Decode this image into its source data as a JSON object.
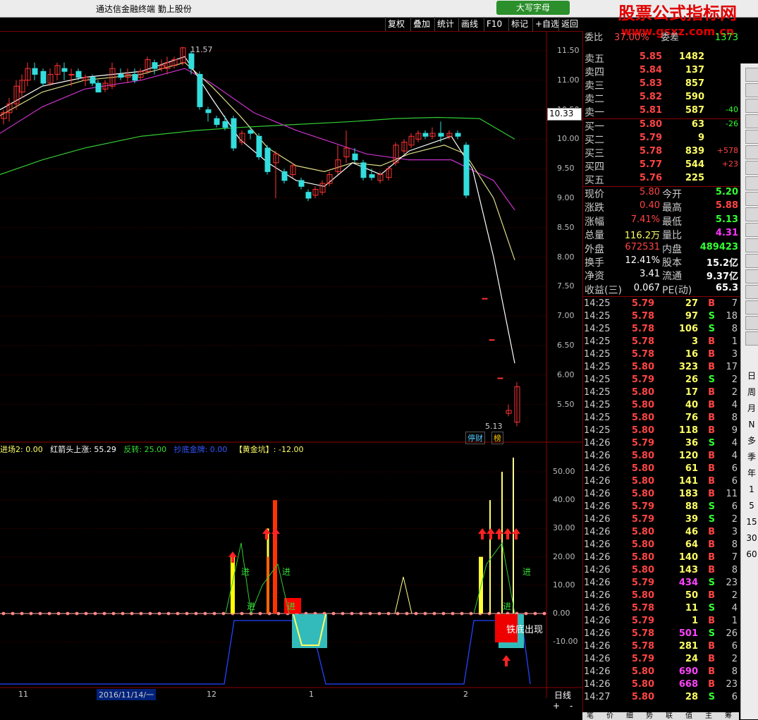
{
  "window": {
    "title": "通达信金融终端  勤上股份",
    "ime_label": "大写字母"
  },
  "watermark": {
    "line1": "股票公式指标网",
    "line2": "www.gsxz.com.cn"
  },
  "toolbar": {
    "items": [
      "复权",
      "叠加",
      "统计",
      "画线",
      "F10",
      "标记",
      "+自选",
      "返回"
    ]
  },
  "price_axis": {
    "labels": [
      "11.50",
      "11.00",
      "10.50",
      "10.00",
      "9.50",
      "9.00",
      "8.50",
      "8.00",
      "7.50",
      "7.00",
      "6.50",
      "6.00",
      "5.50"
    ],
    "current_price_tag": "10.33"
  },
  "main_chart": {
    "high_label": "11.57",
    "low_label": "5.13",
    "badges": [
      "停财",
      "榜"
    ]
  },
  "indicator": {
    "legend": [
      {
        "text": "进场2: 0.00",
        "color": "#ffff66"
      },
      {
        "text": "红箭头上涨: 55.29",
        "color": "#ffffff"
      },
      {
        "text": "反转: 25.00",
        "color": "#33dd33"
      },
      {
        "text": "抄底金牌: 0.00",
        "color": "#3355ff"
      },
      {
        "text": "【黄金坑】: -12.00",
        "color": "#ffff66"
      }
    ],
    "axis_labels": [
      "50.00",
      "40.00",
      "30.00",
      "20.00",
      "10.00",
      "0.00",
      "-10.00"
    ],
    "annotations": {
      "jin1": "进",
      "jin2": "进",
      "jin3": "进",
      "jin4": "进",
      "jin5": "进",
      "jin6": "进",
      "tiedi": "铁底出现"
    }
  },
  "date_axis": {
    "labels": [
      "11",
      "2016/11/14/一",
      "12",
      "1",
      "2"
    ],
    "period": "日线"
  },
  "quote": {
    "top_row": {
      "label": "委比",
      "value": "37.00%",
      "label2": "委差",
      "value2": "1373"
    },
    "sells": [
      {
        "label": "卖五",
        "price": "5.85",
        "vol": "1482",
        "chg": ""
      },
      {
        "label": "卖四",
        "price": "5.84",
        "vol": "137",
        "chg": ""
      },
      {
        "label": "卖三",
        "price": "5.83",
        "vol": "857",
        "chg": ""
      },
      {
        "label": "卖二",
        "price": "5.82",
        "vol": "590",
        "chg": ""
      },
      {
        "label": "卖一",
        "price": "5.81",
        "vol": "587",
        "chg": "-40"
      }
    ],
    "buys": [
      {
        "label": "买一",
        "price": "5.80",
        "vol": "63",
        "chg": "-26"
      },
      {
        "label": "买二",
        "price": "5.79",
        "vol": "9",
        "chg": ""
      },
      {
        "label": "买三",
        "price": "5.78",
        "vol": "839",
        "chg": "+578"
      },
      {
        "label": "买四",
        "price": "5.77",
        "vol": "544",
        "chg": "+23"
      },
      {
        "label": "买五",
        "price": "5.76",
        "vol": "225",
        "chg": ""
      }
    ],
    "stats": [
      {
        "l1": "现价",
        "v1": "5.80",
        "l2": "今开",
        "v2": "5.20",
        "c1": "#ff4444",
        "c2": "#33ff33"
      },
      {
        "l1": "涨跌",
        "v1": "0.40",
        "l2": "最高",
        "v2": "5.88",
        "c1": "#ff4444",
        "c2": "#ff4444"
      },
      {
        "l1": "涨幅",
        "v1": "7.41%",
        "l2": "最低",
        "v2": "5.13",
        "c1": "#ff4444",
        "c2": "#33ff33"
      },
      {
        "l1": "总量",
        "v1": "116.2万",
        "l2": "量比",
        "v2": "4.31",
        "c1": "#ffff66",
        "c2": "#ff33ff"
      },
      {
        "l1": "外盘",
        "v1": "672531",
        "l2": "内盘",
        "v2": "489423",
        "c1": "#ff4444",
        "c2": "#33ff33"
      },
      {
        "l1": "换手",
        "v1": "12.41%",
        "l2": "股本",
        "v2": "15.2亿",
        "c1": "#ffffff",
        "c2": "#ffffff"
      },
      {
        "l1": "净资",
        "v1": "3.41",
        "l2": "流通",
        "v2": "9.37亿",
        "c1": "#ffffff",
        "c2": "#ffffff"
      },
      {
        "l1": "收益(三)",
        "v1": "0.067",
        "l2": "PE(动)",
        "v2": "65.3",
        "c1": "#ffffff",
        "c2": "#ffffff"
      }
    ],
    "ticks": [
      [
        "14:25",
        "5.79",
        "27",
        "B",
        "7"
      ],
      [
        "14:25",
        "5.78",
        "97",
        "S",
        "18"
      ],
      [
        "14:25",
        "5.78",
        "106",
        "S",
        "8"
      ],
      [
        "14:25",
        "5.78",
        "3",
        "B",
        "1"
      ],
      [
        "14:25",
        "5.78",
        "16",
        "B",
        "3"
      ],
      [
        "14:25",
        "5.80",
        "323",
        "B",
        "17"
      ],
      [
        "14:25",
        "5.79",
        "26",
        "S",
        "2"
      ],
      [
        "14:25",
        "5.80",
        "17",
        "B",
        "2"
      ],
      [
        "14:25",
        "5.80",
        "40",
        "B",
        "4"
      ],
      [
        "14:25",
        "5.80",
        "76",
        "B",
        "8"
      ],
      [
        "14:25",
        "5.80",
        "118",
        "B",
        "9"
      ],
      [
        "14:26",
        "5.79",
        "36",
        "S",
        "4"
      ],
      [
        "14:26",
        "5.80",
        "120",
        "B",
        "4"
      ],
      [
        "14:26",
        "5.80",
        "61",
        "B",
        "6"
      ],
      [
        "14:26",
        "5.80",
        "141",
        "B",
        "6"
      ],
      [
        "14:26",
        "5.80",
        "183",
        "B",
        "11"
      ],
      [
        "14:26",
        "5.79",
        "88",
        "S",
        "6"
      ],
      [
        "14:26",
        "5.79",
        "39",
        "S",
        "2"
      ],
      [
        "14:26",
        "5.80",
        "46",
        "B",
        "3"
      ],
      [
        "14:26",
        "5.80",
        "64",
        "B",
        "8"
      ],
      [
        "14:26",
        "5.80",
        "140",
        "B",
        "7"
      ],
      [
        "14:26",
        "5.80",
        "143",
        "B",
        "8"
      ],
      [
        "14:26",
        "5.79",
        "434",
        "S",
        "23"
      ],
      [
        "14:26",
        "5.80",
        "50",
        "B",
        "2"
      ],
      [
        "14:26",
        "5.78",
        "11",
        "S",
        "4"
      ],
      [
        "14:26",
        "5.79",
        "1",
        "B",
        "1"
      ],
      [
        "14:26",
        "5.78",
        "501",
        "S",
        "26"
      ],
      [
        "14:26",
        "5.78",
        "281",
        "B",
        "6"
      ],
      [
        "14:26",
        "5.79",
        "24",
        "B",
        "2"
      ],
      [
        "14:26",
        "5.80",
        "690",
        "B",
        "8"
      ],
      [
        "14:26",
        "5.80",
        "668",
        "B",
        "23"
      ],
      [
        "14:27",
        "5.80",
        "28",
        "S",
        "6"
      ]
    ],
    "bottom_tabs": [
      "笔",
      "价",
      "细",
      "势",
      "联",
      "值",
      "主",
      "筹"
    ]
  },
  "sidebar": {
    "items": [
      "日",
      "周",
      "月",
      "N",
      "多",
      "季",
      "年",
      "1",
      "5",
      "15",
      "30",
      "60"
    ]
  },
  "colors": {
    "up": "#ff3333",
    "down": "#33dddd",
    "grid": "#5a0000",
    "border": "#8b0000"
  }
}
